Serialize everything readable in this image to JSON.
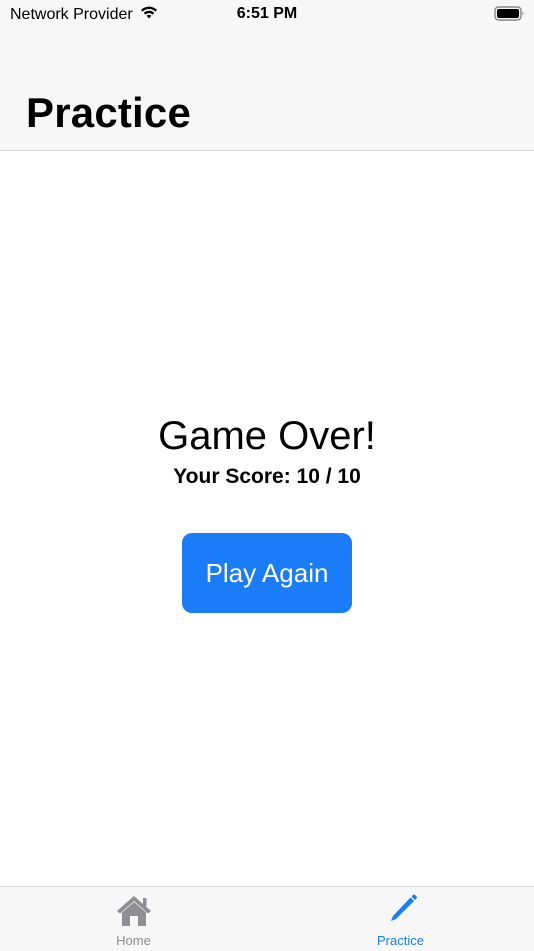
{
  "status_bar": {
    "carrier": "Network Provider",
    "time": "6:51 PM",
    "wifi_icon": "wifi-icon",
    "battery_icon": "battery-icon"
  },
  "nav": {
    "title": "Practice"
  },
  "content": {
    "heading": "Game Over!",
    "score_text": "Your Score: 10 / 10",
    "play_again_label": "Play Again"
  },
  "tab_bar": {
    "tabs": [
      {
        "label": "Home",
        "icon": "house-icon",
        "selected": false
      },
      {
        "label": "Practice",
        "icon": "pencil-icon",
        "selected": true
      }
    ]
  },
  "colors": {
    "accent": "#1a7cf6",
    "tab_inactive": "#8e8e93",
    "bar_background": "#f7f7f7"
  }
}
